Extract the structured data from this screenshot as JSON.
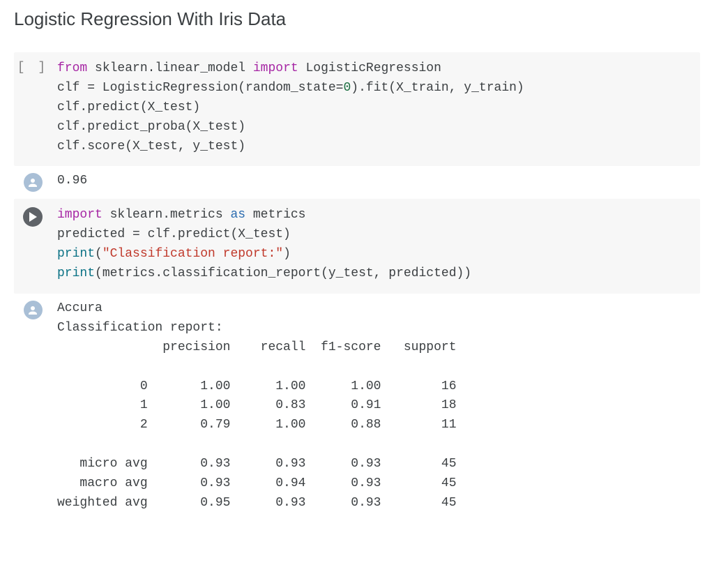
{
  "section_title": "Logistic Regression With Iris Data",
  "cell1": {
    "bracket": "[ ]",
    "line1": {
      "kw1": "from",
      "mod": " sklearn.linear_model ",
      "kw2": "import",
      "name": " LogisticRegression"
    },
    "line2": {
      "a": "clf = LogisticRegression(random_state=",
      "num": "0",
      "b": ").fit(X_train, y_train)"
    },
    "line3": "clf.predict(X_test)",
    "line4": "clf.predict_proba(X_test)",
    "line5": "clf.score(X_test, y_test)"
  },
  "out1": {
    "value": "0.96"
  },
  "cell2": {
    "line1": {
      "kw1": "import",
      "mod": " sklearn.metrics ",
      "kw2": "as",
      "name": " metrics"
    },
    "line2": "predicted = clf.predict(X_test)",
    "line3": {
      "fn": "print",
      "paren1": "(",
      "str": "\"Classification report:\"",
      "paren2": ")"
    },
    "line4": {
      "fn": "print",
      "rest": "(metrics.classification_report(y_test, predicted))"
    }
  },
  "out2": {
    "text": "Accura\nClassification report:\n              precision    recall  f1-score   support\n\n           0       1.00      1.00      1.00        16\n           1       1.00      0.83      0.91        18\n           2       0.79      1.00      0.88        11\n\n   micro avg       0.93      0.93      0.93        45\n   macro avg       0.93      0.94      0.93        45\nweighted avg       0.95      0.93      0.93        45"
  }
}
